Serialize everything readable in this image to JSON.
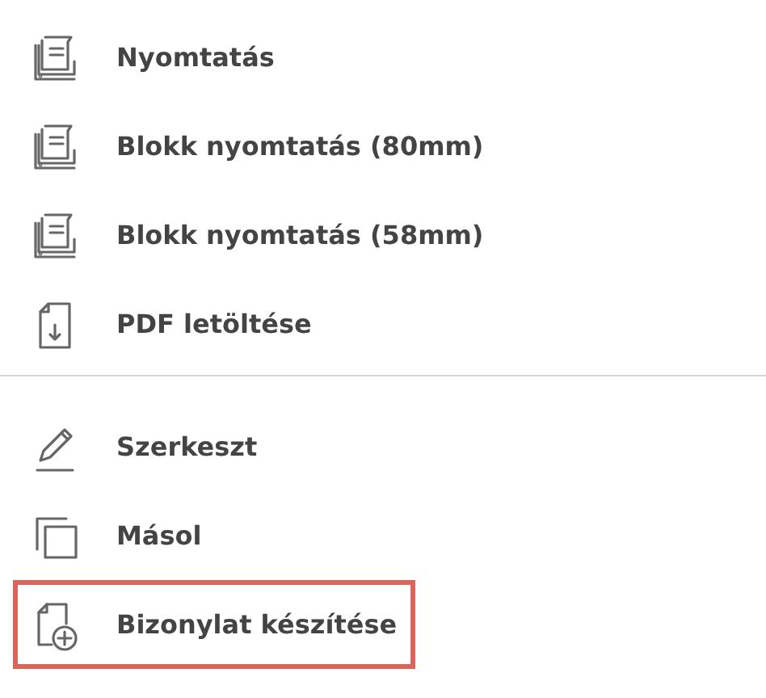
{
  "sections": [
    {
      "items": [
        {
          "kind": "printer",
          "label": "Nyomtatás",
          "highlighted": false
        },
        {
          "kind": "printer",
          "label": "Blokk nyomtatás (80mm)",
          "highlighted": false
        },
        {
          "kind": "printer",
          "label": "Blokk nyomtatás (58mm)",
          "highlighted": false
        },
        {
          "kind": "pdf",
          "label": "PDF letöltése",
          "highlighted": false
        }
      ]
    },
    {
      "items": [
        {
          "kind": "edit",
          "label": "Szerkeszt",
          "highlighted": false
        },
        {
          "kind": "copy",
          "label": "Másol",
          "highlighted": false
        },
        {
          "kind": "new-document",
          "label": "Bizonylat készítése",
          "highlighted": true
        }
      ]
    }
  ]
}
